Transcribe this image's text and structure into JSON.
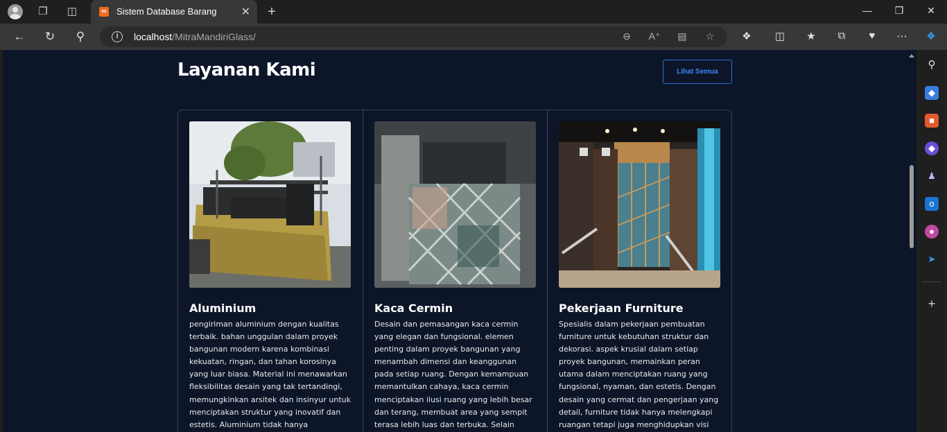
{
  "browser": {
    "tab_title": "Sistem Database Barang",
    "url_host": "localhost",
    "url_path": "/MitraMandiriGlass/"
  },
  "page": {
    "section_title": "Layanan Kami",
    "see_all_label": "Lihat Semua",
    "cards": [
      {
        "title": "Aluminium",
        "image": "aluminium-truck-photo",
        "description": "pengiriman aluminium dengan kualitas terbaik. bahan unggulan dalam proyek bangunan modern karena kombinasi kekuatan, ringan, dan tahan korosinya yang luar biasa. Material ini menawarkan fleksibilitas desain yang tak tertandingi, memungkinkan arsitek dan insinyur untuk menciptakan struktur yang inovatif dan estetis. Aluminium tidak hanya"
      },
      {
        "title": "Kaca Cermin",
        "image": "mirror-panels-photo",
        "description": "Desain dan pemasangan kaca cermin yang elegan dan fungsional. elemen penting dalam proyek bangunan yang menambah dimensi dan keanggunan pada setiap ruang. Dengan kemampuan memantulkan cahaya, kaca cermin menciptakan ilusi ruang yang lebih besar dan terang, membuat area yang sempit terasa lebih luas dan terbuka. Selain fungsinya yang praktis, kaca cermin juga"
      },
      {
        "title": "Pekerjaan Furniture",
        "image": "elevator-interior-photo",
        "description": "Spesialis dalam pekerjaan pembuatan furniture untuk kebutuhan struktur dan dekorasi. aspek krusial dalam setiap proyek bangunan, memainkan peran utama dalam menciptakan ruang yang fungsional, nyaman, dan estetis. Dengan desain yang cermat dan pengerjaan yang detail, furniture tidak hanya melengkapi ruangan tetapi juga menghidupkan visi arsitektur dan interior."
      }
    ]
  },
  "colors": {
    "page_background": "#0d1628",
    "accent": "#3d86ff",
    "card_border": "#3a4358"
  }
}
